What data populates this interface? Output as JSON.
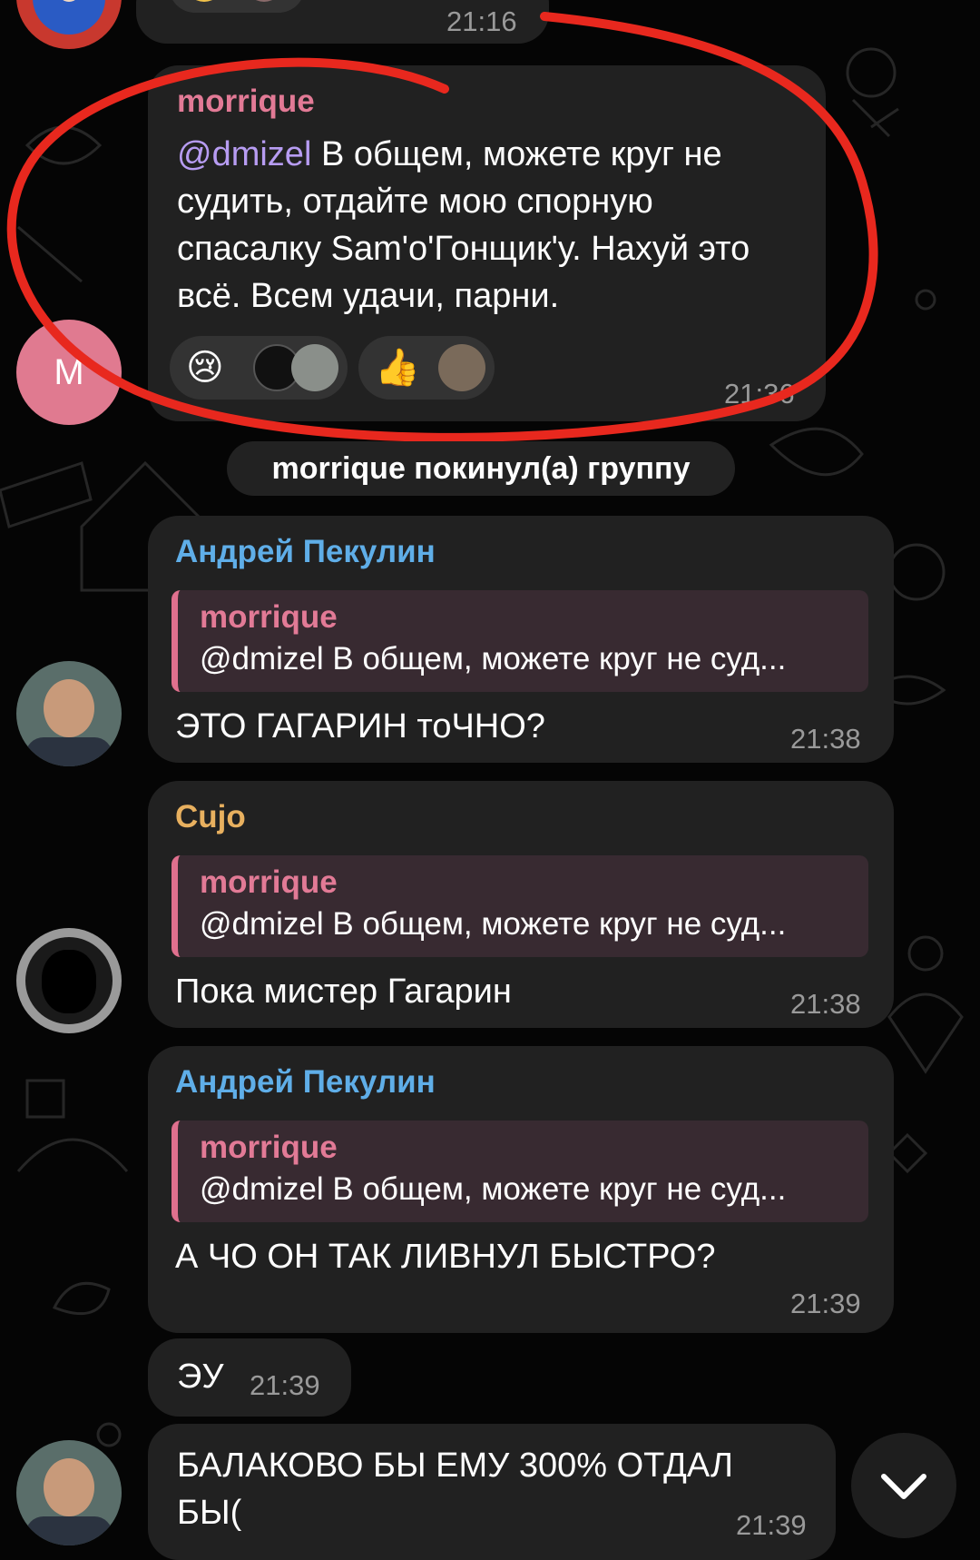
{
  "messages": {
    "prev": {
      "time": "21:16"
    },
    "morrique": {
      "sender": "morrique",
      "mention": "@dmizel",
      "text": " В общем, можете круг не судить, отдайте мою спорную спасалку Sam'o'Гонщик'у.  Нахуй это всё. Всем удачи, парни.",
      "avatar_letter": "M",
      "time": "21:36",
      "reactions": [
        {
          "emoji": "😢",
          "icon": "crying-face-icon"
        },
        {
          "emoji": "👍",
          "icon": "thumbs-up-icon"
        }
      ],
      "colors": {
        "sender": "#e27a96",
        "mention": "#b79cf2"
      }
    },
    "system": "morrique покинул(а) группу",
    "msg1": {
      "sender": "Андрей Пекулин",
      "reply_name": "morrique",
      "reply_text": "@dmizel В общем, можете круг не суд...",
      "text": "ЭТО ГАГАРИН тоЧНО?",
      "time": "21:38",
      "sender_color": "#5faee8"
    },
    "msg2": {
      "sender": "Cujo",
      "reply_name": "morrique",
      "reply_text": "@dmizel В общем, можете круг не суд...",
      "text": "Пока мистер Гагарин",
      "time": "21:38",
      "sender_color": "#e8b05f"
    },
    "msg3": {
      "sender": "Андрей Пекулин",
      "reply_name": "morrique",
      "reply_text": "@dmizel В общем, можете круг не суд...",
      "text": "А ЧО ОН ТАК ЛИВНУЛ БЫСТРО?",
      "time": "21:39",
      "sender_color": "#5faee8"
    },
    "msg4": {
      "text": "ЭУ",
      "time": "21:39"
    },
    "msg5": {
      "text_line1": "БАЛАКОВО БЫ ЕМУ 300% ОТДАЛ",
      "text_line2": "БЫ(",
      "time": "21:39"
    }
  },
  "annotation_color": "#e8281e",
  "icons": [
    "crying-face-icon",
    "thumbs-up-icon",
    "chevron-down-icon"
  ]
}
